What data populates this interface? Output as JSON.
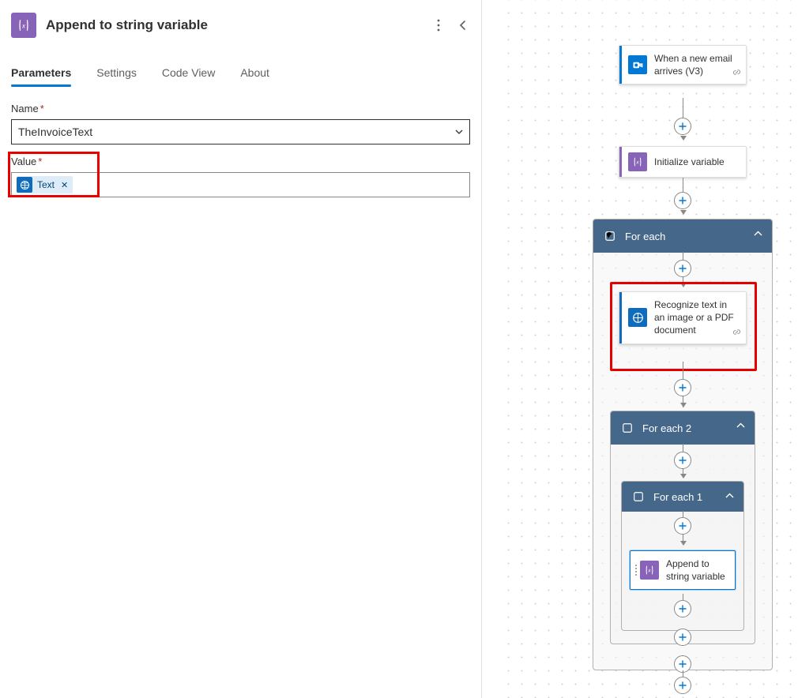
{
  "panel": {
    "title": "Append to string variable",
    "tabs": [
      "Parameters",
      "Settings",
      "Code View",
      "About"
    ],
    "active_tab": 0,
    "fields": {
      "name_label": "Name",
      "name_value": "TheInvoiceText",
      "value_label": "Value",
      "value_token": "Text"
    }
  },
  "flow": {
    "nodes": {
      "email": {
        "label": "When a new email arrives (V3)"
      },
      "initvar": {
        "label": "Initialize variable"
      },
      "foreach": {
        "label": "For each"
      },
      "ocr": {
        "label": "Recognize text in an image or a PDF document"
      },
      "foreach2": {
        "label": "For each 2"
      },
      "foreach1": {
        "label": "For each 1"
      },
      "append": {
        "label": "Append to string variable"
      }
    }
  }
}
